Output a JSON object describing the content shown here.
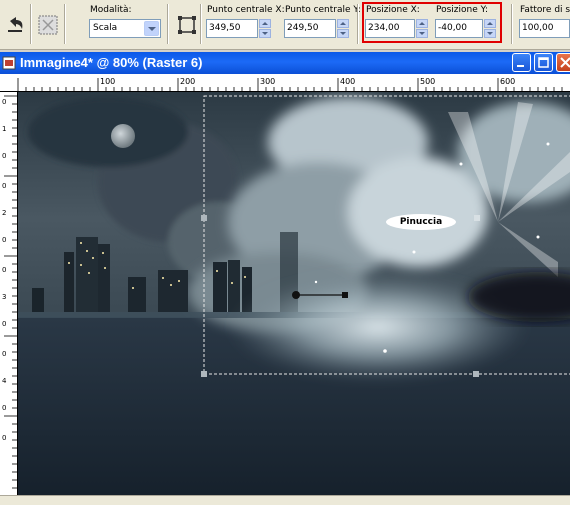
{
  "toolbar": {
    "mode_label": "Modalità:",
    "mode_value": "Scala",
    "center_x_label": "Punto centrale X:",
    "center_x_value": "349,50",
    "center_y_label": "Punto centrale Y:",
    "center_y_value": "249,50",
    "pos_x_label": "Posizione X:",
    "pos_x_value": "234,00",
    "pos_y_label": "Posizione Y:",
    "pos_y_value": "-40,00",
    "scale_label": "Fattore di sc",
    "scale_value": "100,00",
    "icons": [
      "undo-icon",
      "deform-icon",
      "deform-frame-icon"
    ]
  },
  "window": {
    "title": "Immagine4* @  80% (Raster 6)",
    "buttons": [
      "minimize-icon",
      "maximize-icon",
      "close-icon"
    ]
  },
  "rulers": {
    "top_labels": [
      "100",
      "200",
      "300",
      "400",
      "500",
      "600"
    ],
    "left_labels": [
      "0",
      "1",
      "0",
      "0",
      "2",
      "0",
      "0",
      "3",
      "0",
      "0",
      "4",
      "0",
      "0"
    ]
  },
  "canvas": {
    "text_label": "Pinuccia"
  },
  "colors": {
    "highlight": "#e00000",
    "title_bar": "#0a58e8",
    "sky": "#33414c",
    "water": "#1d2935"
  }
}
